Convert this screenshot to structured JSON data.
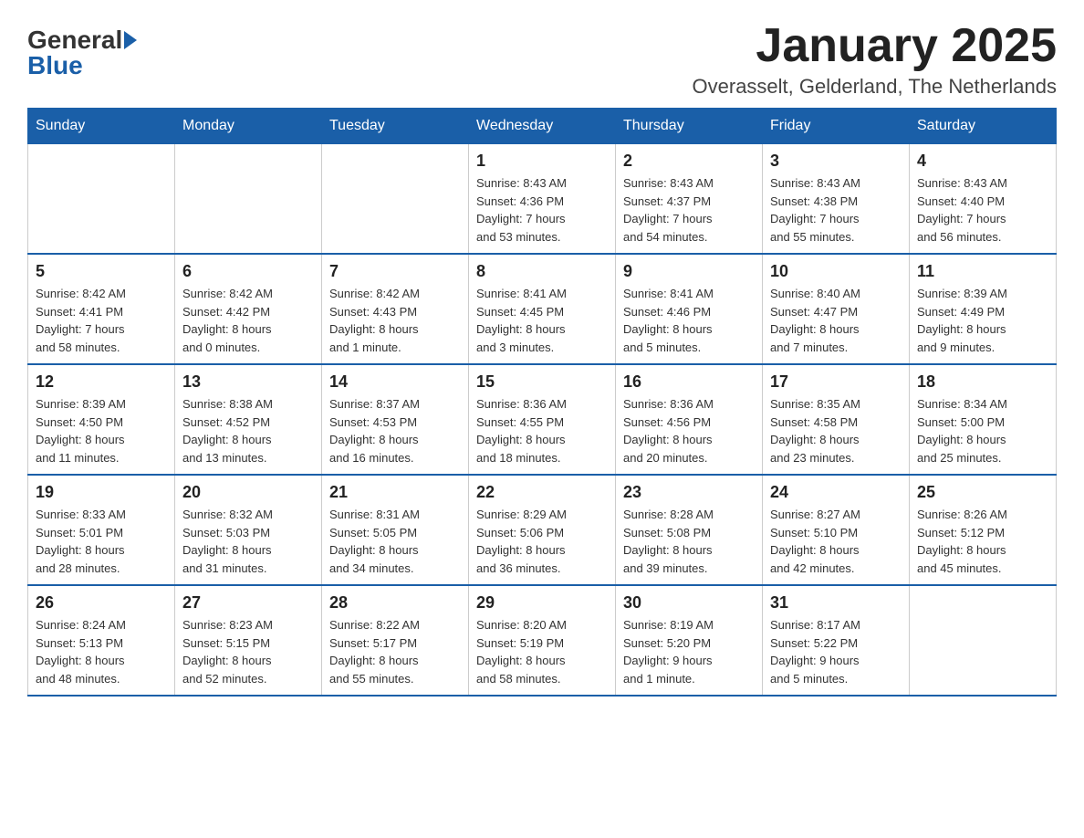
{
  "logo": {
    "text_general": "General",
    "arrow": "▶",
    "text_blue": "Blue"
  },
  "title": "January 2025",
  "subtitle": "Overasselt, Gelderland, The Netherlands",
  "days_of_week": [
    "Sunday",
    "Monday",
    "Tuesday",
    "Wednesday",
    "Thursday",
    "Friday",
    "Saturday"
  ],
  "weeks": [
    [
      {
        "day": "",
        "info": ""
      },
      {
        "day": "",
        "info": ""
      },
      {
        "day": "",
        "info": ""
      },
      {
        "day": "1",
        "info": "Sunrise: 8:43 AM\nSunset: 4:36 PM\nDaylight: 7 hours\nand 53 minutes."
      },
      {
        "day": "2",
        "info": "Sunrise: 8:43 AM\nSunset: 4:37 PM\nDaylight: 7 hours\nand 54 minutes."
      },
      {
        "day": "3",
        "info": "Sunrise: 8:43 AM\nSunset: 4:38 PM\nDaylight: 7 hours\nand 55 minutes."
      },
      {
        "day": "4",
        "info": "Sunrise: 8:43 AM\nSunset: 4:40 PM\nDaylight: 7 hours\nand 56 minutes."
      }
    ],
    [
      {
        "day": "5",
        "info": "Sunrise: 8:42 AM\nSunset: 4:41 PM\nDaylight: 7 hours\nand 58 minutes."
      },
      {
        "day": "6",
        "info": "Sunrise: 8:42 AM\nSunset: 4:42 PM\nDaylight: 8 hours\nand 0 minutes."
      },
      {
        "day": "7",
        "info": "Sunrise: 8:42 AM\nSunset: 4:43 PM\nDaylight: 8 hours\nand 1 minute."
      },
      {
        "day": "8",
        "info": "Sunrise: 8:41 AM\nSunset: 4:45 PM\nDaylight: 8 hours\nand 3 minutes."
      },
      {
        "day": "9",
        "info": "Sunrise: 8:41 AM\nSunset: 4:46 PM\nDaylight: 8 hours\nand 5 minutes."
      },
      {
        "day": "10",
        "info": "Sunrise: 8:40 AM\nSunset: 4:47 PM\nDaylight: 8 hours\nand 7 minutes."
      },
      {
        "day": "11",
        "info": "Sunrise: 8:39 AM\nSunset: 4:49 PM\nDaylight: 8 hours\nand 9 minutes."
      }
    ],
    [
      {
        "day": "12",
        "info": "Sunrise: 8:39 AM\nSunset: 4:50 PM\nDaylight: 8 hours\nand 11 minutes."
      },
      {
        "day": "13",
        "info": "Sunrise: 8:38 AM\nSunset: 4:52 PM\nDaylight: 8 hours\nand 13 minutes."
      },
      {
        "day": "14",
        "info": "Sunrise: 8:37 AM\nSunset: 4:53 PM\nDaylight: 8 hours\nand 16 minutes."
      },
      {
        "day": "15",
        "info": "Sunrise: 8:36 AM\nSunset: 4:55 PM\nDaylight: 8 hours\nand 18 minutes."
      },
      {
        "day": "16",
        "info": "Sunrise: 8:36 AM\nSunset: 4:56 PM\nDaylight: 8 hours\nand 20 minutes."
      },
      {
        "day": "17",
        "info": "Sunrise: 8:35 AM\nSunset: 4:58 PM\nDaylight: 8 hours\nand 23 minutes."
      },
      {
        "day": "18",
        "info": "Sunrise: 8:34 AM\nSunset: 5:00 PM\nDaylight: 8 hours\nand 25 minutes."
      }
    ],
    [
      {
        "day": "19",
        "info": "Sunrise: 8:33 AM\nSunset: 5:01 PM\nDaylight: 8 hours\nand 28 minutes."
      },
      {
        "day": "20",
        "info": "Sunrise: 8:32 AM\nSunset: 5:03 PM\nDaylight: 8 hours\nand 31 minutes."
      },
      {
        "day": "21",
        "info": "Sunrise: 8:31 AM\nSunset: 5:05 PM\nDaylight: 8 hours\nand 34 minutes."
      },
      {
        "day": "22",
        "info": "Sunrise: 8:29 AM\nSunset: 5:06 PM\nDaylight: 8 hours\nand 36 minutes."
      },
      {
        "day": "23",
        "info": "Sunrise: 8:28 AM\nSunset: 5:08 PM\nDaylight: 8 hours\nand 39 minutes."
      },
      {
        "day": "24",
        "info": "Sunrise: 8:27 AM\nSunset: 5:10 PM\nDaylight: 8 hours\nand 42 minutes."
      },
      {
        "day": "25",
        "info": "Sunrise: 8:26 AM\nSunset: 5:12 PM\nDaylight: 8 hours\nand 45 minutes."
      }
    ],
    [
      {
        "day": "26",
        "info": "Sunrise: 8:24 AM\nSunset: 5:13 PM\nDaylight: 8 hours\nand 48 minutes."
      },
      {
        "day": "27",
        "info": "Sunrise: 8:23 AM\nSunset: 5:15 PM\nDaylight: 8 hours\nand 52 minutes."
      },
      {
        "day": "28",
        "info": "Sunrise: 8:22 AM\nSunset: 5:17 PM\nDaylight: 8 hours\nand 55 minutes."
      },
      {
        "day": "29",
        "info": "Sunrise: 8:20 AM\nSunset: 5:19 PM\nDaylight: 8 hours\nand 58 minutes."
      },
      {
        "day": "30",
        "info": "Sunrise: 8:19 AM\nSunset: 5:20 PM\nDaylight: 9 hours\nand 1 minute."
      },
      {
        "day": "31",
        "info": "Sunrise: 8:17 AM\nSunset: 5:22 PM\nDaylight: 9 hours\nand 5 minutes."
      },
      {
        "day": "",
        "info": ""
      }
    ]
  ]
}
